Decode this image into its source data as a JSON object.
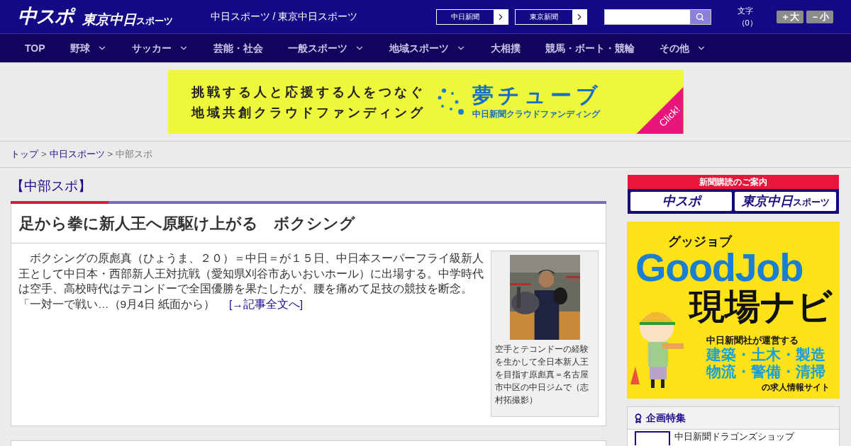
{
  "header": {
    "logo_main": "中スポ",
    "logo_sub": "東京中日",
    "logo_sub_small": "スポーツ",
    "site_title": "中日スポーツ / 東京中日スポーツ",
    "paper_links": [
      "中日新聞",
      "東京新聞"
    ],
    "font_size_label": "文字（0）",
    "font_buttons": [
      "＋大",
      "－小"
    ]
  },
  "nav": [
    {
      "label": "TOP",
      "dropdown": false
    },
    {
      "label": "野球",
      "dropdown": true
    },
    {
      "label": "サッカー",
      "dropdown": true
    },
    {
      "label": "芸能・社会",
      "dropdown": false
    },
    {
      "label": "一般スポーツ",
      "dropdown": true
    },
    {
      "label": "地域スポーツ",
      "dropdown": true
    },
    {
      "label": "大相撲",
      "dropdown": false
    },
    {
      "label": "競馬・ボート・競輪",
      "dropdown": false
    },
    {
      "label": "その他",
      "dropdown": true
    }
  ],
  "banner": {
    "lines": [
      "挑戦する人と応援する人をつなぐ",
      "地域共創クラウドファンディング"
    ],
    "brand": "夢チューブ",
    "brand_sub": "中日新聞クラウドファンディング",
    "corner": "Click!"
  },
  "breadcrumb": [
    {
      "label": "トップ",
      "link": true
    },
    {
      "separator": ">",
      "label": "中日スポーツ",
      "link": true
    },
    {
      "separator": ">",
      "label": "中部スポ",
      "link": false
    }
  ],
  "section_title": "【中部スポ】",
  "article": {
    "title": "足から拳に新人王へ原駆け上がる　ボクシング",
    "body": "　ボクシングの原彪真（ひょうま、２０）＝中日＝が１５日、中日本スーパーフライ級新人王として中日本・西部新人王対抗戦（愛知県刈谷市あいおいホール）に出場する。中学時代は空手、高校時代はテコンドーで全国優勝を果たしたが、腰を痛めて足技の競技を断念。「一対一で戦い…（9月4日 紙面から）",
    "more_link": "[→記事全文へ]",
    "photo": {
      "kind": "picture",
      "caption": "空手とテコンドーの経験を生かして全日本新人王を目指す原彪真＝名古屋市中区の中日ジムで（志村拓撮影）"
    }
  },
  "sidebar": {
    "subscribe_title": "新聞購読のご案内",
    "subscribe_buttons": [
      "中スポ",
      "東京中日"
    ],
    "subscribe_small": "スポーツ",
    "ad": {
      "kana": "グッジョブ",
      "logo": "GoodJob",
      "title": "現場ナビ",
      "operator": "中日新聞社が運営する",
      "fields": [
        "建築・土木・製造",
        "物流・警備・清掃"
      ],
      "tail": "の求人情報サイト"
    },
    "feature_title": "企画特集",
    "feature_items": [
      "中日新聞ドラゴンズショップ"
    ]
  }
}
